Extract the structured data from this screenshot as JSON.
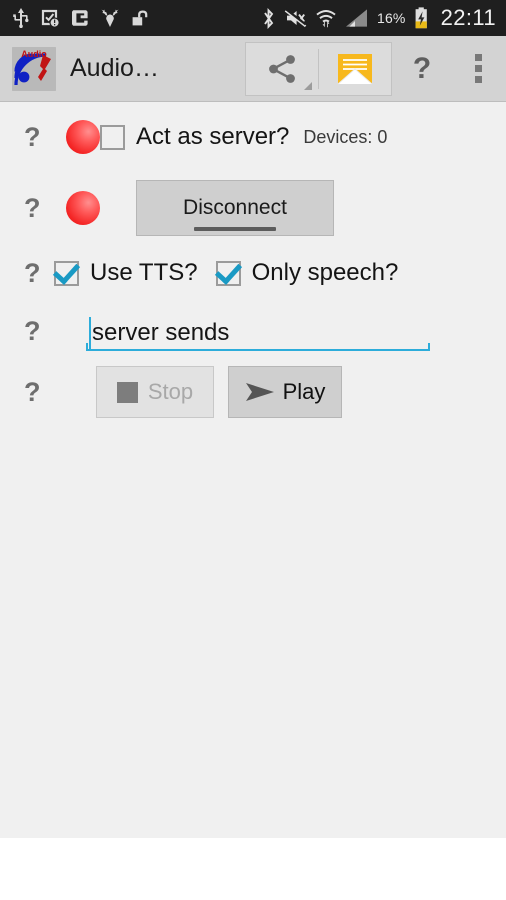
{
  "status_bar": {
    "background": "#1f1f1f",
    "left_icons": [
      {
        "name": "usb-icon",
        "label": "USB"
      },
      {
        "name": "app-update-alert-icon",
        "label": "App alert"
      },
      {
        "name": "gameloft-g-icon",
        "label": "G app"
      },
      {
        "name": "deer-head-icon",
        "label": "Deer app"
      },
      {
        "name": "unlocked-padlock-icon",
        "label": "Unlocked"
      }
    ],
    "right_icons": [
      {
        "name": "bluetooth-icon",
        "label": "Bluetooth"
      },
      {
        "name": "mute-vibrate-icon",
        "label": "Sound off"
      },
      {
        "name": "wifi-icon",
        "label": "Wi-Fi"
      },
      {
        "name": "cell-signal-icon",
        "label": "Signal"
      }
    ],
    "battery_percent": "16%",
    "battery_charging": true,
    "clock": "22:11"
  },
  "action_bar": {
    "background": "#d3d3d3",
    "app_icon_name": "audio-app-icon",
    "app_icon_text": "Audio",
    "title": "Audio…",
    "buttons": [
      {
        "name": "share-button",
        "icon": "share-icon",
        "label": "Share"
      },
      {
        "name": "email-button",
        "icon": "envelope-icon",
        "label": "Email"
      }
    ],
    "help_label": "?",
    "overflow_label": "More options"
  },
  "main": {
    "background": "#f0f0f0",
    "help_marker": "?",
    "rows": {
      "server": {
        "help": "?",
        "led_name": "status-led-red",
        "led_color": "#f42626",
        "checkbox_checked": false,
        "checkbox_label": "Act as server?",
        "devices_text": "Devices: 0"
      },
      "connection": {
        "help": "?",
        "led_name": "connection-led-red",
        "led_color": "#f42626",
        "button_label": "Disconnect"
      },
      "tts": {
        "help": "?",
        "use_tts_checked": true,
        "use_tts_label": "Use TTS?",
        "only_speech_checked": true,
        "only_speech_label": "Only speech?"
      },
      "message": {
        "help": "?",
        "input_value": "server sends",
        "input_placeholder": "",
        "accent_color": "#2cacda"
      },
      "transport": {
        "help": "?",
        "stop_label": "Stop",
        "stop_disabled": true,
        "play_label": "Play",
        "play_disabled": false
      }
    }
  }
}
